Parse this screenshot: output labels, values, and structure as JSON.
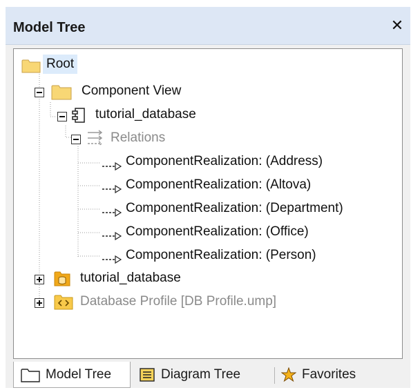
{
  "panel": {
    "title": "Model Tree",
    "close_glyph": "✕"
  },
  "tree": {
    "root": "Root",
    "component_view": "Component View",
    "component": "tutorial_database",
    "relations": "Relations",
    "realizations": [
      "ComponentRealization:  (Address)",
      "ComponentRealization:  (Altova)",
      "ComponentRealization:  (Department)",
      "ComponentRealization:  (Office)",
      "ComponentRealization:  (Person)"
    ],
    "package": "tutorial_database",
    "profile": "Database Profile [DB Profile.ump]"
  },
  "tabs": [
    {
      "label": "Model Tree",
      "icon": "folder-icon",
      "active": true
    },
    {
      "label": "Diagram Tree",
      "icon": "diagram-tree-icon",
      "active": false
    },
    {
      "label": "Favorites",
      "icon": "favorites-icon",
      "active": false
    }
  ],
  "colors": {
    "title_bg": "#dde7f5",
    "selection": "#dcebfb",
    "folder": "#f8d775",
    "package": "#f0a81a",
    "disabled_text": "#8a8a8a"
  }
}
